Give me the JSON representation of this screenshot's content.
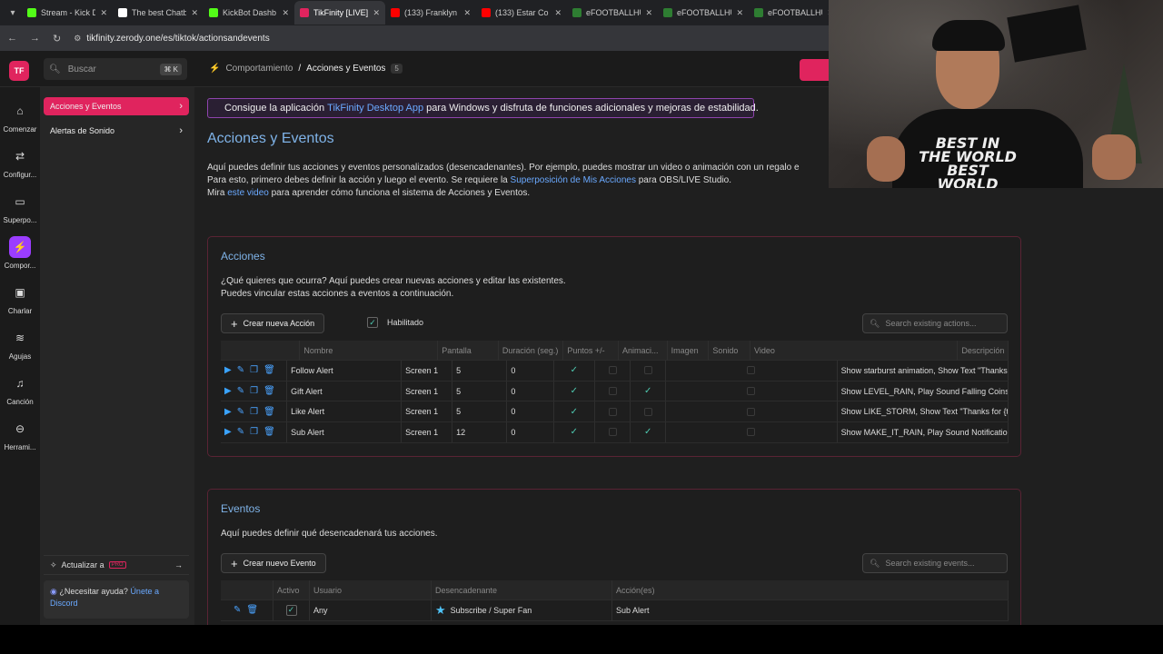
{
  "tabs": [
    {
      "title": "Stream - Kick D",
      "fav_color": "#53fc18",
      "active": false
    },
    {
      "title": "The best Chatb",
      "fav_color": "#ffffff",
      "active": false
    },
    {
      "title": "KickBot Dashb",
      "fav_color": "#53fc18",
      "active": false
    },
    {
      "title": "TikFinity [LIVE]",
      "fav_color": "#e0245e",
      "active": true
    },
    {
      "title": "(133) Franklyn",
      "fav_color": "#ff0000",
      "active": false
    },
    {
      "title": "(133) Estar Co",
      "fav_color": "#ff0000",
      "active": false
    },
    {
      "title": "eFOOTBALLHU",
      "fav_color": "#2e7d32",
      "active": false
    },
    {
      "title": "eFOOTBALLHU",
      "fav_color": "#2e7d32",
      "active": false
    },
    {
      "title": "eFOOTBALLHU",
      "fav_color": "#2e7d32",
      "active": false
    }
  ],
  "url": "tikfinity.zerody.one/es/tiktok/actionsandevents",
  "search": {
    "placeholder": "Buscar",
    "shortcut": "⌘ K"
  },
  "breadcrumb": {
    "parent": "Comportamiento",
    "sep": "/",
    "current": "Acciones y Eventos",
    "count": "5"
  },
  "rail": [
    {
      "label": "Comenzar",
      "icon": "⌂"
    },
    {
      "label": "Configur...",
      "icon": "⇄"
    },
    {
      "label": "Superpo...",
      "icon": "▭"
    },
    {
      "label": "Compor...",
      "icon": "⚡",
      "active": true
    },
    {
      "label": "Charlar",
      "icon": "▣"
    },
    {
      "label": "Agujas",
      "icon": "≋"
    },
    {
      "label": "Canción",
      "icon": "♫"
    },
    {
      "label": "Herrami...",
      "icon": "⊖"
    }
  ],
  "subnav": [
    {
      "label": "Acciones y Eventos",
      "active": true
    },
    {
      "label": "Alertas de Sonido",
      "active": false
    }
  ],
  "upgrade": {
    "label": "Actualizar a",
    "badge": "PRO"
  },
  "help": {
    "q": "¿Necesitar ayuda?",
    "link1": "Únete a",
    "link2": "Discord"
  },
  "promo": {
    "pre": "Consigue la aplicación ",
    "link": "TikFinity Desktop App",
    "post": " para Windows y disfruta de funciones adicionales y mejoras de estabilidad."
  },
  "page_title": "Acciones y Eventos",
  "intro": {
    "line1": "Aquí puedes definir tus acciones y eventos personalizados (desencadenantes). Por ejemplo, puedes mostrar un video o animación con un regalo e",
    "line2_pre": "Para esto, primero debes definir la acción y luego el evento. Se requiere la ",
    "line2_link": "Superposición de Mis Acciones",
    "line2_post": " para OBS/LIVE Studio.",
    "line3_pre": "Mira ",
    "line3_link": "este video",
    "line3_post": " para aprender cómo funciona el sistema de Acciones y Eventos."
  },
  "acciones": {
    "title": "Acciones",
    "desc1": "¿Qué quieres que ocurra? Aquí puedes crear nuevas acciones y editar las existentes.",
    "desc2": "Puedes vincular estas acciones a eventos a continuación.",
    "create_label": "Crear nueva Acción",
    "enabled_label": "Habilitado",
    "search_placeholder": "Search existing actions...",
    "headers": [
      "Nombre",
      "Pantalla",
      "Duración (seg.)",
      "Puntos +/-",
      "Animaci...",
      "Imagen",
      "Sonido",
      "Video",
      "Descripción"
    ],
    "rows": [
      {
        "name": "Follow Alert",
        "screen": "Screen 1",
        "duration": "5",
        "points": "0",
        "anim": true,
        "image": false,
        "sound": false,
        "video": false,
        "desc": "Show starburst animation, Show Text \"Thanks for fol..."
      },
      {
        "name": "Gift Alert",
        "screen": "Screen 1",
        "duration": "5",
        "points": "0",
        "anim": true,
        "image": false,
        "sound": true,
        "video": false,
        "desc": "Show LEVEL_RAIN, Play Sound Falling Coins, Show T..."
      },
      {
        "name": "Like Alert",
        "screen": "Screen 1",
        "duration": "5",
        "points": "0",
        "anim": true,
        "image": false,
        "sound": false,
        "video": false,
        "desc": "Show LIKE_STORM, Show Text \"Thanks for {totallikec..."
      },
      {
        "name": "Sub Alert",
        "screen": "Screen 1",
        "duration": "12",
        "points": "0",
        "anim": true,
        "image": false,
        "sound": true,
        "video": false,
        "desc": "Show MAKE_IT_RAIN, Play Sound Notification Alert, ..."
      }
    ]
  },
  "eventos": {
    "title": "Eventos",
    "desc": "Aquí puedes definir qué desencadenará tus acciones.",
    "create_label": "Crear nuevo Evento",
    "search_placeholder": "Search existing events...",
    "headers": [
      "Activo",
      "Usuario",
      "Desencadenante",
      "Acción(es)"
    ],
    "rows": [
      {
        "active": true,
        "user": "Any",
        "trigger": "Subscribe / Super Fan",
        "action": "Sub Alert"
      }
    ]
  },
  "webcam": {
    "shirt_text": "BEST IN THE WORLD BEST WORLD BEST WORLD"
  }
}
